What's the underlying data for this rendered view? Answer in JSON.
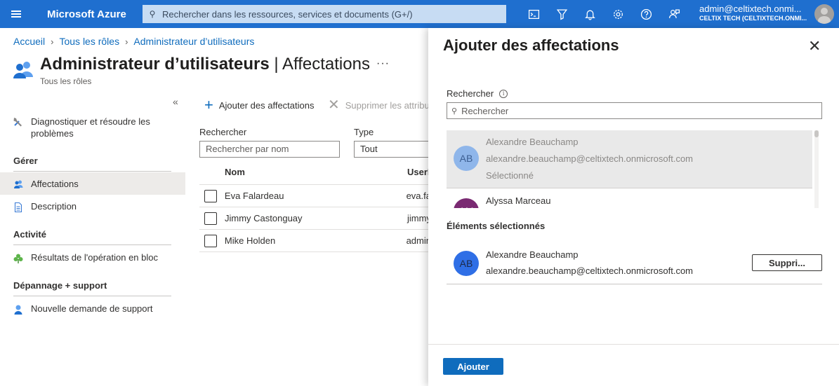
{
  "topbar": {
    "brand": "Microsoft Azure",
    "search_placeholder": "Rechercher dans les ressources, services et documents (G+/)",
    "account_email": "admin@celtixtech.onmi...",
    "account_tenant": "CELTIX TECH (CELTIXTECH.ONMI..."
  },
  "breadcrumb": [
    "Accueil",
    "Tous les rôles",
    "Administrateur d’utilisateurs"
  ],
  "page": {
    "title": "Administrateur d’utilisateurs",
    "title_suffix": "| Affectations",
    "subtitle": "Tous les rôles",
    "more": "···"
  },
  "nav": {
    "collapse": "«",
    "diagnose": "Diagnostiquer et résoudre les problèmes",
    "section_manage": "Gérer",
    "assignments": "Affectations",
    "description": "Description",
    "section_activity": "Activité",
    "bulk_results": "Résultats de l'opération en bloc",
    "section_support": "Dépannage + support",
    "new_support": "Nouvelle demande de support"
  },
  "toolbar": {
    "add": "Ajouter des affectations",
    "remove": "Supprimer les attribu"
  },
  "filters": {
    "search_label": "Rechercher",
    "search_placeholder": "Rechercher par nom",
    "type_label": "Type",
    "type_value": "Tout"
  },
  "table": {
    "headers": [
      "Nom",
      "UserN"
    ],
    "rows": [
      {
        "name": "Eva Falardeau",
        "upn": "eva.fa"
      },
      {
        "name": "Jimmy Castonguay",
        "upn": "jimmy"
      },
      {
        "name": "Mike Holden",
        "upn": "admin"
      }
    ]
  },
  "panel": {
    "title": "Ajouter des affectations",
    "close": "✕",
    "search_label": "Rechercher",
    "search_placeholder": "Rechercher",
    "results": [
      {
        "initials": "AB",
        "name": "Alexandre Beauchamp",
        "email": "alexandre.beauchamp@celtixtech.onmicrosoft.com",
        "status": "Sélectionné"
      },
      {
        "initials": "AM",
        "name": "Alyssa Marceau"
      }
    ],
    "selected_title": "Éléments sélectionnés",
    "selected": {
      "initials": "AB",
      "name": "Alexandre Beauchamp",
      "email": "alexandre.beauchamp@celtixtech.onmicrosoft.com",
      "remove_label": "Suppri..."
    },
    "add_button": "Ajouter"
  }
}
